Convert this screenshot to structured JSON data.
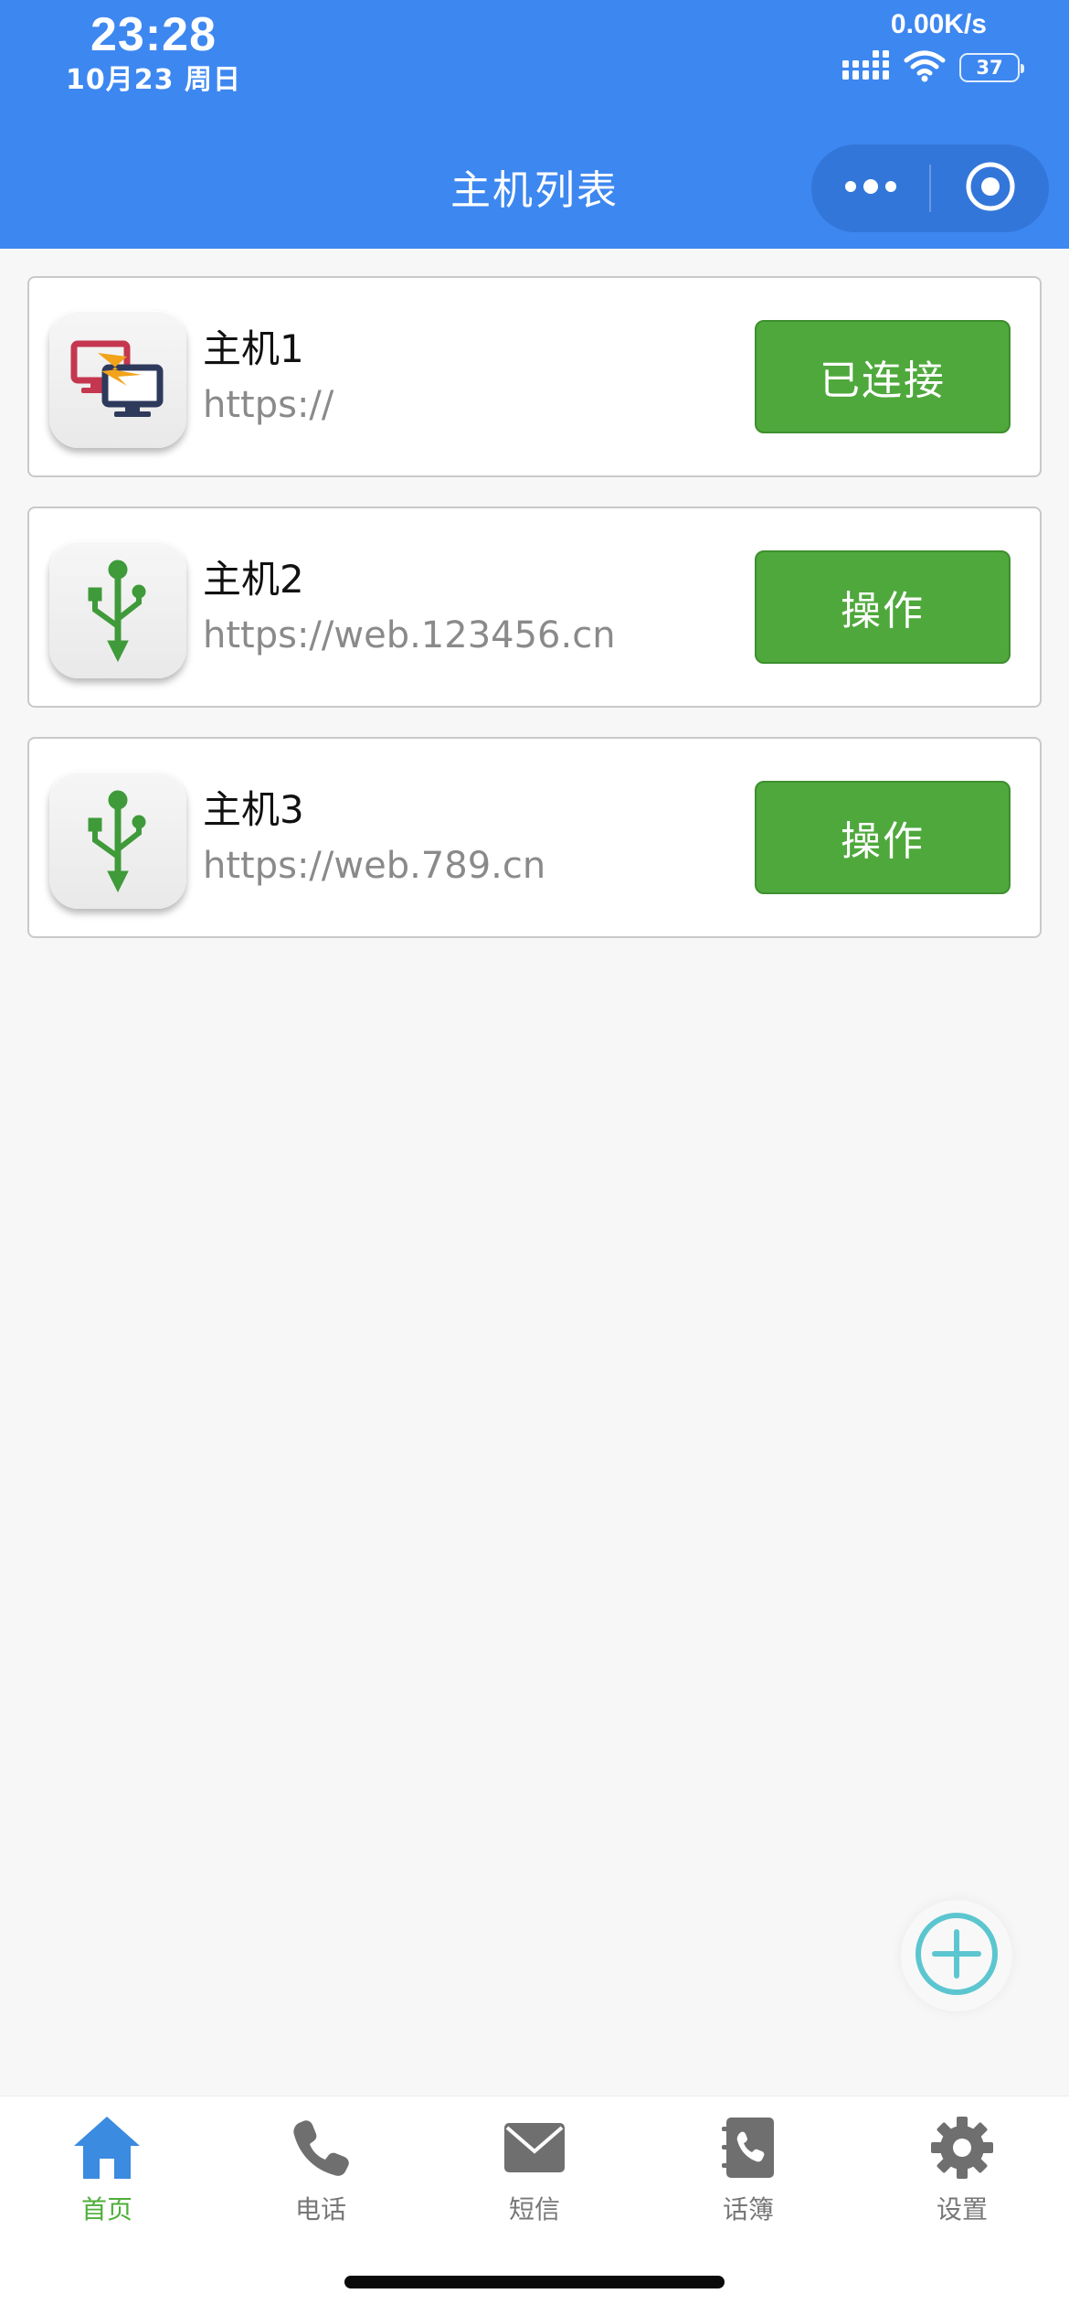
{
  "status_bar": {
    "time": "23:28",
    "date": "10月23 周日",
    "net_speed": "0.00K/s",
    "battery": "37",
    "icons": [
      "signal-icon",
      "wifi-icon",
      "battery-icon"
    ]
  },
  "nav": {
    "title": "主机列表",
    "capsule_icons": [
      "more-dots-icon",
      "close-target-icon"
    ]
  },
  "hosts": [
    {
      "name": "主机1",
      "url": "https://",
      "button": "已连接",
      "icon": "remote-desktop-icon"
    },
    {
      "name": "主机2",
      "url": "https://web.123456.cn",
      "button": "操作",
      "icon": "usb-icon"
    },
    {
      "name": "主机3",
      "url": "https://web.789.cn",
      "button": "操作",
      "icon": "usb-icon"
    }
  ],
  "fab": {
    "icon": "add-circle-icon"
  },
  "tabbar": {
    "items": [
      {
        "label": "首页",
        "icon": "home-icon",
        "active": true
      },
      {
        "label": "电话",
        "icon": "phone-icon",
        "active": false
      },
      {
        "label": "短信",
        "icon": "mail-icon",
        "active": false
      },
      {
        "label": "话簿",
        "icon": "contacts-book-icon",
        "active": false
      },
      {
        "label": "设置",
        "icon": "settings-gear-icon",
        "active": false
      }
    ]
  },
  "colors": {
    "header": "#3d87f0",
    "button_green": "#4fa83c",
    "active_tab": "#4fae3a",
    "home_icon_blue": "#3b8be0",
    "fab_teal": "#5cc6d0"
  }
}
